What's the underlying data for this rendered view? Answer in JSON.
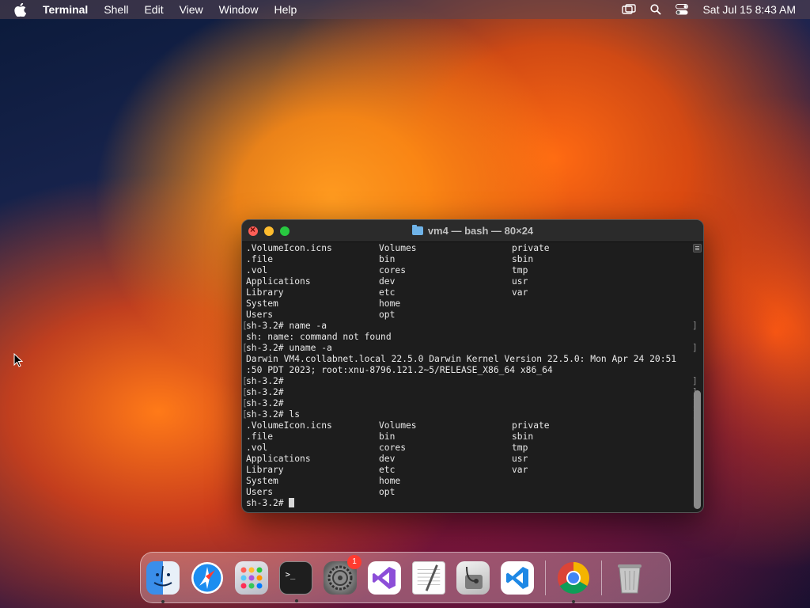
{
  "menubar": {
    "app_name": "Terminal",
    "items": [
      "Shell",
      "Edit",
      "View",
      "Window",
      "Help"
    ],
    "datetime": "Sat Jul 15  8:43 AM"
  },
  "window": {
    "title": "vm4 — bash — 80×24"
  },
  "terminal": {
    "listing_1": [
      [
        ".VolumeIcon.icns",
        "Volumes",
        "private"
      ],
      [
        ".file",
        "bin",
        "sbin"
      ],
      [
        ".vol",
        "cores",
        "tmp"
      ],
      [
        "Applications",
        "dev",
        "usr"
      ],
      [
        "Library",
        "etc",
        "var"
      ],
      [
        "System",
        "home",
        ""
      ],
      [
        "Users",
        "opt",
        ""
      ]
    ],
    "lines_mid": [
      "sh-3.2# name -a",
      "sh: name: command not found",
      "sh-3.2# uname -a",
      "Darwin VM4.collabnet.local 22.5.0 Darwin Kernel Version 22.5.0: Mon Apr 24 20:51",
      ":50 PDT 2023; root:xnu-8796.121.2~5/RELEASE_X86_64 x86_64",
      "sh-3.2#",
      "sh-3.2#",
      "sh-3.2#",
      "sh-3.2# ls"
    ],
    "listing_2": [
      [
        ".VolumeIcon.icns",
        "Volumes",
        "private"
      ],
      [
        ".file",
        "bin",
        "sbin"
      ],
      [
        ".vol",
        "cores",
        "tmp"
      ],
      [
        "Applications",
        "dev",
        "usr"
      ],
      [
        "Library",
        "etc",
        "var"
      ],
      [
        "System",
        "home",
        ""
      ],
      [
        "Users",
        "opt",
        ""
      ]
    ],
    "prompt": "sh-3.2# "
  },
  "dock": {
    "apps": [
      "finder-icon",
      "safari-icon",
      "launchpad-icon",
      "terminal-icon",
      "system-settings-icon",
      "visual-studio-icon",
      "textedit-icon",
      "disk-utility-icon",
      "vscode-icon",
      "chrome-icon",
      "trash-icon"
    ],
    "settings_badge": "1"
  }
}
